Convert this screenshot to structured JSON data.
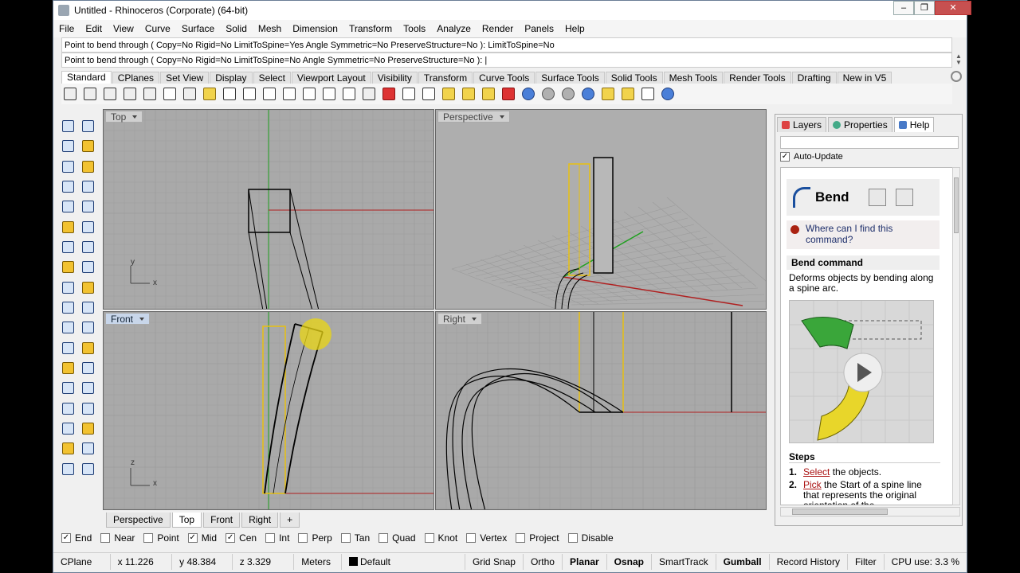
{
  "window": {
    "title": "Untitled - Rhinoceros (Corporate) (64-bit)"
  },
  "menu": [
    "File",
    "Edit",
    "View",
    "Curve",
    "Surface",
    "Solid",
    "Mesh",
    "Dimension",
    "Transform",
    "Tools",
    "Analyze",
    "Render",
    "Panels",
    "Help"
  ],
  "command": {
    "history": "Point to bend through ( Copy=No  Rigid=No  LimitToSpine=Yes  Angle  Symmetric=No  PreserveStructure=No ): LimitToSpine=No",
    "prompt": "Point to bend through ( Copy=No  Rigid=No  LimitToSpine=No  Angle  Symmetric=No  PreserveStructure=No ): |"
  },
  "toolbar_tabs": [
    "Standard",
    "CPlanes",
    "Set View",
    "Display",
    "Select",
    "Viewport Layout",
    "Visibility",
    "Transform",
    "Curve Tools",
    "Surface Tools",
    "Solid Tools",
    "Mesh Tools",
    "Render Tools",
    "Drafting",
    "New in V5"
  ],
  "viewports": {
    "top": {
      "label": "Top"
    },
    "perspective": {
      "label": "Perspective"
    },
    "front": {
      "label": "Front"
    },
    "right": {
      "label": "Right"
    },
    "axes": {
      "x": "x",
      "y": "y",
      "z": "z"
    }
  },
  "viewport_tabs": [
    "Perspective",
    "Top",
    "Front",
    "Right"
  ],
  "panel": {
    "tabs": [
      "Layers",
      "Properties",
      "Help"
    ],
    "auto_update": "Auto-Update",
    "help": {
      "title": "Bend",
      "where": "Where can I find this command?",
      "section": "Bend command",
      "description": "Deforms objects by bending along a spine arc.",
      "steps_title": "Steps",
      "steps": [
        {
          "n": "1.",
          "link": "Select",
          "text": " the objects."
        },
        {
          "n": "2.",
          "link": "Pick",
          "text": " the Start of a spine line that represents the original orientation of the"
        }
      ]
    }
  },
  "osnaps": [
    {
      "label": "End",
      "checked": true
    },
    {
      "label": "Near",
      "checked": false
    },
    {
      "label": "Point",
      "checked": false
    },
    {
      "label": "Mid",
      "checked": true
    },
    {
      "label": "Cen",
      "checked": true
    },
    {
      "label": "Int",
      "checked": false
    },
    {
      "label": "Perp",
      "checked": false
    },
    {
      "label": "Tan",
      "checked": false
    },
    {
      "label": "Quad",
      "checked": false
    },
    {
      "label": "Knot",
      "checked": false
    },
    {
      "label": "Vertex",
      "checked": false
    },
    {
      "label": "Project",
      "checked": false
    },
    {
      "label": "Disable",
      "checked": false
    }
  ],
  "status": {
    "cplane": "CPlane",
    "x": "x 11.226",
    "y": "y 48.384",
    "z": "z 3.329",
    "units": "Meters",
    "layer": "Default",
    "grid_snap": "Grid Snap",
    "ortho": "Ortho",
    "planar": "Planar",
    "osnap": "Osnap",
    "smarttrack": "SmartTrack",
    "gumball": "Gumball",
    "record_history": "Record History",
    "filter": "Filter",
    "cpu": "CPU use: 3.3 %"
  },
  "colors": {
    "layer_swatch": "#000000",
    "grid": "#9e9e9e",
    "x_axis": "#b02020",
    "y_axis": "#20a020",
    "selection": "#e8c010"
  }
}
